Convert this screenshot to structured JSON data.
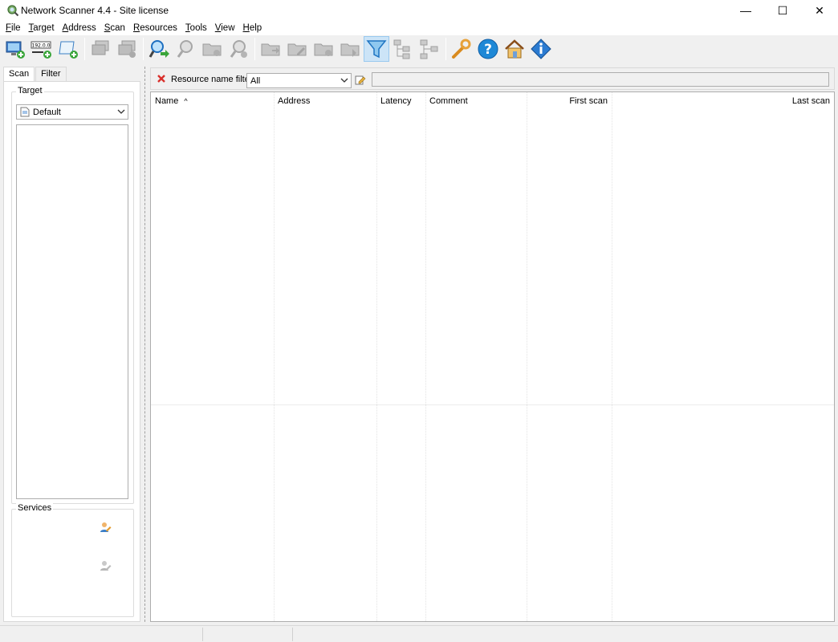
{
  "window": {
    "title": "Network Scanner 4.4 - Site license",
    "minimize": "—",
    "maximize": "☐",
    "close": "✕"
  },
  "menu": [
    {
      "label": "File",
      "key": "F",
      "rest": "ile"
    },
    {
      "label": "Target",
      "key": "T",
      "rest": "arget"
    },
    {
      "label": "Address",
      "key": "A",
      "rest": "ddress"
    },
    {
      "label": "Scan",
      "key": "S",
      "rest": "can"
    },
    {
      "label": "Resources",
      "key": "R",
      "rest": "esources"
    },
    {
      "label": "Tools",
      "key": "T",
      "rest": "ools"
    },
    {
      "label": "View",
      "key": "V",
      "rest": "iew"
    },
    {
      "label": "Help",
      "key": "H",
      "rest": "elp"
    }
  ],
  "toolbar": {
    "ip_badge": "192.0.0"
  },
  "left_panel": {
    "tabs": [
      "Scan",
      "Filter"
    ],
    "target_group": "Target",
    "target_value": "Default",
    "services_group": "Services"
  },
  "filter": {
    "label": "Resource name filter",
    "combo_value": "All"
  },
  "grid": {
    "columns": [
      "Name",
      "Address",
      "Latency",
      "Comment",
      "First scan",
      "Last scan"
    ],
    "sort_indicator": "^"
  },
  "colors": {
    "accent": "#1e88d6",
    "active_bg": "#cce4f7",
    "clear_red": "#d9302c"
  }
}
